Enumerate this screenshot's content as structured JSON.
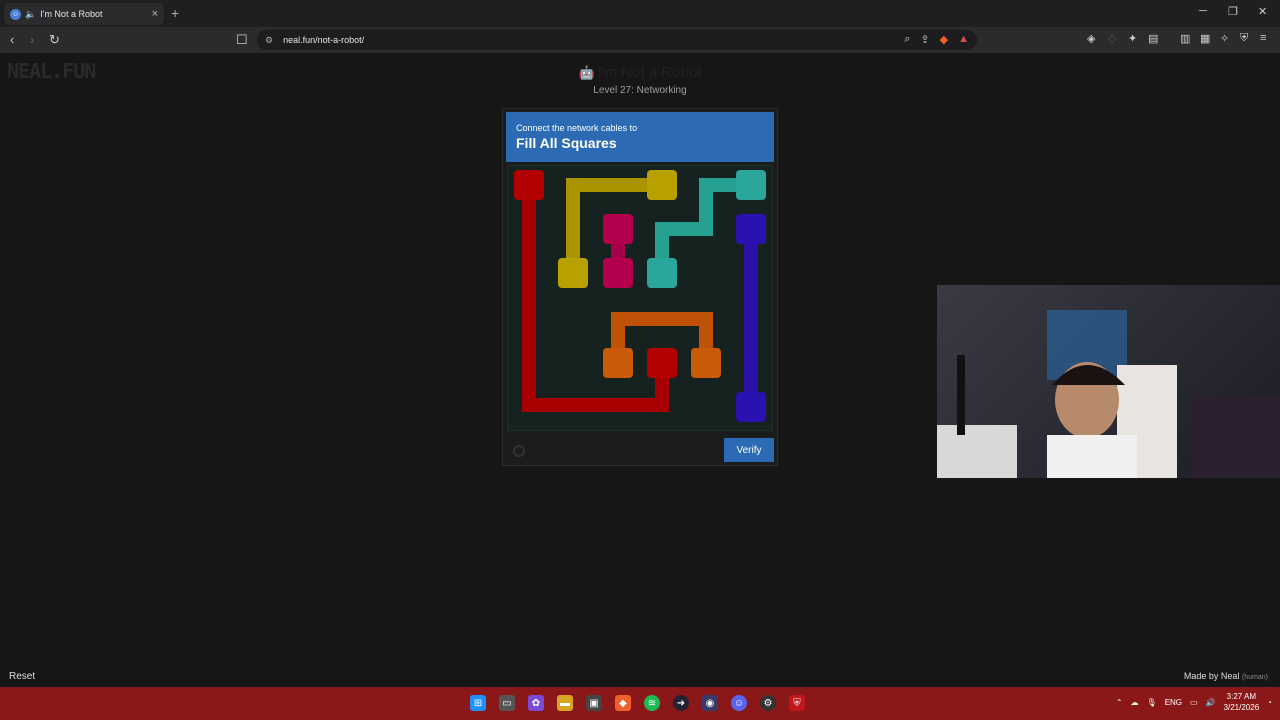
{
  "browser": {
    "tab_title": "I'm Not a Robot",
    "url": "neal.fun/not-a-robot/"
  },
  "page": {
    "logo": "NEAL.FUN",
    "title": "I'm Not a Robot",
    "level": "Level 27: Networking",
    "reset_label": "Reset",
    "made_by": "Made by Neal",
    "made_by_note": "(human)"
  },
  "captcha": {
    "subtitle": "Connect the network cables to",
    "heading": "Fill All Squares",
    "verify_label": "Verify",
    "header_color": "#2c6bb4",
    "cable_colors": {
      "red": "#b30000",
      "yellow": "#b8a000",
      "magenta": "#b3004d",
      "teal": "#2aa79a",
      "orange": "#c85a0a",
      "blue": "#2a12b0"
    }
  },
  "taskbar": {
    "lang": "ENG",
    "time": "3:27 AM",
    "date": "3/21/2026"
  }
}
